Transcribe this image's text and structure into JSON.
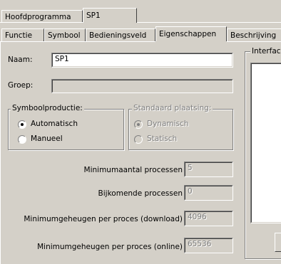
{
  "window_tabs": [
    "Hoofdprogramma",
    "SP1"
  ],
  "property_tabs": [
    "Functie",
    "Symbool",
    "Bedieningsveld",
    "Eigenschappen",
    "Beschrijving"
  ],
  "active_property_tab": "Eigenschappen",
  "form": {
    "name_label": "Naam:",
    "name_value": "SP1",
    "group_label": "Groep:",
    "group_value": ""
  },
  "symbol_group": {
    "title": "Symboolproductie:",
    "options": [
      "Automatisch",
      "Manueel"
    ],
    "selected": "Automatisch"
  },
  "placement_group": {
    "title": "Standaard plaatsing:",
    "options": [
      "Dynamisch",
      "Statisch"
    ],
    "selected": "Dynamisch",
    "disabled": true
  },
  "params": [
    {
      "label": "Minimumaantal processen",
      "value": "5"
    },
    {
      "label": "Bijkomende processen",
      "value": "0"
    },
    {
      "label": "Minimumgeheugen per proces (download)",
      "value": "4096"
    },
    {
      "label": "Minimumgeheugen per proces (online)",
      "value": "65536"
    }
  ],
  "interface_group": {
    "title": "Interfac"
  }
}
